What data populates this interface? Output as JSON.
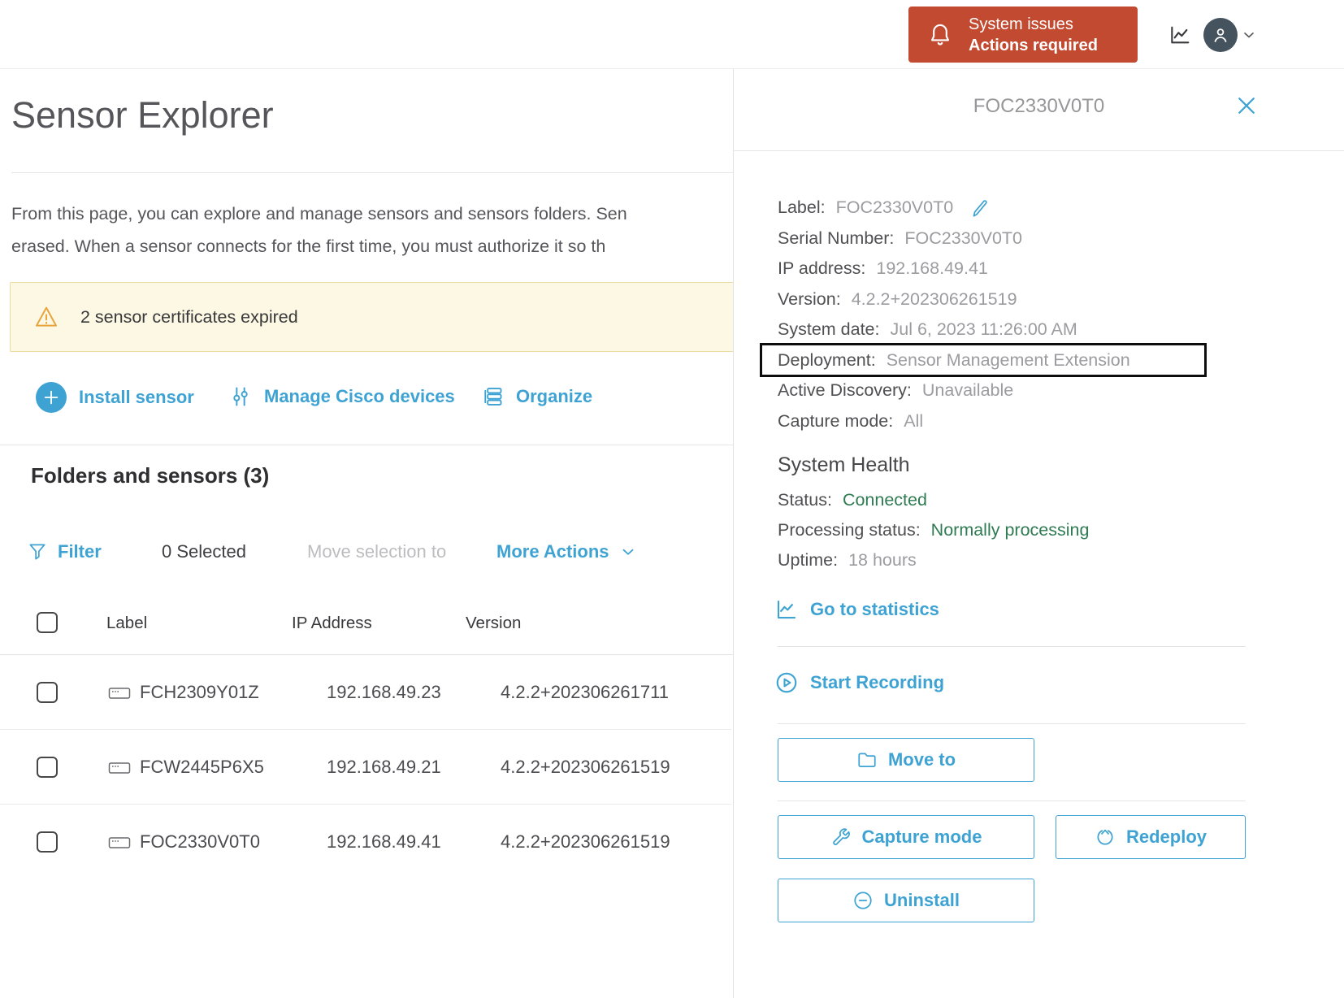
{
  "colors": {
    "accent_blue": "#3EA3D3",
    "alert_red": "#C24A31",
    "success_green": "#2F7B52",
    "warning_bg": "#FCF8E3",
    "warning_border": "#EBDB9E",
    "warning_icon_orange": "#E8A33D",
    "highlight_box_black": "#0D0D0D",
    "avatar_bg": "#44535E"
  },
  "topbar": {
    "system_issues_line1": "System issues",
    "system_issues_line2": "Actions required",
    "icons": [
      "bell-icon",
      "line-chart-icon",
      "user-avatar-icon",
      "chevron-down-icon"
    ]
  },
  "main": {
    "title": "Sensor Explorer",
    "description_line1": "From this page, you can explore and manage sensors and sensors folders. Sen",
    "description_line2": "erased. When a sensor connects for the first time, you must authorize it so th",
    "warning_text": "2 sensor certificates expired",
    "actions": {
      "install": "Install sensor",
      "manage": "Manage Cisco devices",
      "organize": "Organize"
    },
    "section_title": "Folders and sensors (3)",
    "toolbar": {
      "filter": "Filter",
      "selected_count": "0 Selected",
      "move_selection": "Move selection to",
      "more_actions": "More Actions"
    },
    "table": {
      "columns": {
        "label": "Label",
        "ip": "IP Address",
        "version": "Version"
      },
      "rows": [
        {
          "label": "FCH2309Y01Z",
          "ip": "192.168.49.23",
          "version": "4.2.2+202306261711"
        },
        {
          "label": "FCW2445P6X5",
          "ip": "192.168.49.21",
          "version": "4.2.2+202306261519"
        },
        {
          "label": "FOC2330V0T0",
          "ip": "192.168.49.41",
          "version": "4.2.2+202306261519"
        }
      ]
    }
  },
  "panel": {
    "title": "FOC2330V0T0",
    "details": [
      {
        "label": "Label:",
        "value": "FOC2330V0T0"
      },
      {
        "label": "Serial Number:",
        "value": "FOC2330V0T0"
      },
      {
        "label": "IP address:",
        "value": "192.168.49.41"
      },
      {
        "label": "Version:",
        "value": "4.2.2+202306261519"
      },
      {
        "label": "System date:",
        "value": "Jul 6, 2023 11:26:00 AM"
      },
      {
        "label": "Deployment:",
        "value": "Sensor Management Extension"
      },
      {
        "label": "Active Discovery:",
        "value": "Unavailable"
      },
      {
        "label": "Capture mode:",
        "value": "All"
      }
    ],
    "system_health": {
      "title": "System Health",
      "status_label": "Status:",
      "status_value": "Connected",
      "processing_label": "Processing status:",
      "processing_value": "Normally processing",
      "uptime_label": "Uptime:",
      "uptime_value": "18 hours"
    },
    "links": {
      "statistics": "Go to statistics",
      "recording": "Start Recording"
    },
    "buttons": {
      "move_to": "Move to",
      "capture_mode": "Capture mode",
      "redeploy": "Redeploy",
      "uninstall": "Uninstall"
    }
  }
}
